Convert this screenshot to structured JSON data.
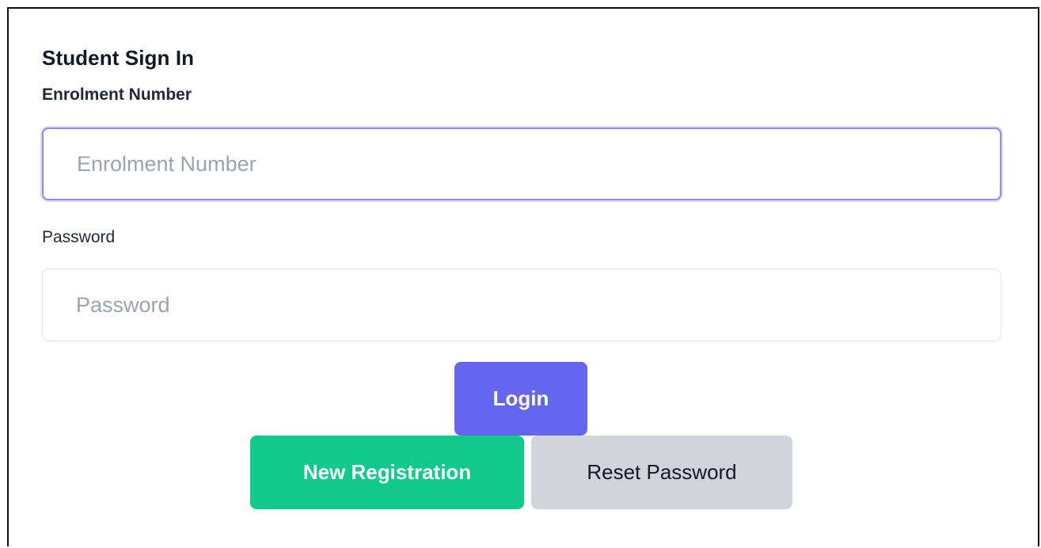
{
  "form": {
    "title": "Student Sign In",
    "enrolment": {
      "label": "Enrolment Number",
      "placeholder": "Enrolment Number",
      "value": ""
    },
    "password": {
      "label": "Password",
      "placeholder": "Password",
      "value": ""
    },
    "buttons": {
      "login": "Login",
      "new_registration": "New Registration",
      "reset_password": "Reset Password"
    }
  },
  "colors": {
    "login_button": "#6366f1",
    "register_button": "#10c98b",
    "reset_button": "#d1d5db",
    "focus_ring": "#8b8cf0"
  }
}
